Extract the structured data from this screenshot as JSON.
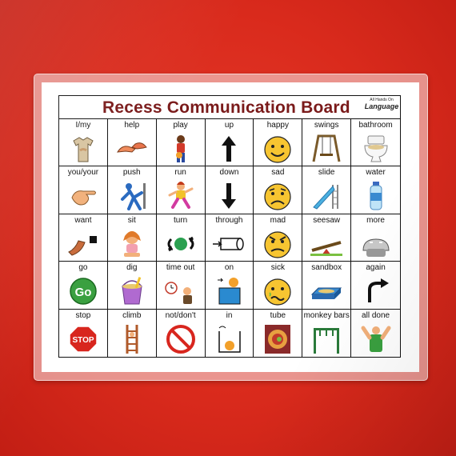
{
  "board": {
    "title": "Recess Communication Board",
    "logo_line1": "All Hands On",
    "logo_line2": "Language",
    "cells": [
      {
        "label": "I/my",
        "icon": "shirt-pointing-self-icon"
      },
      {
        "label": "help",
        "icon": "helping-hands-icon"
      },
      {
        "label": "play",
        "icon": "child-with-ball-icon"
      },
      {
        "label": "up",
        "icon": "arrow-up-icon"
      },
      {
        "label": "happy",
        "icon": "happy-face-icon"
      },
      {
        "label": "swings",
        "icon": "swing-set-icon"
      },
      {
        "label": "bathroom",
        "icon": "toilet-icon"
      },
      {
        "label": "you/your",
        "icon": "pointing-hand-icon"
      },
      {
        "label": "push",
        "icon": "pushing-person-icon"
      },
      {
        "label": "run",
        "icon": "running-child-icon"
      },
      {
        "label": "down",
        "icon": "arrow-down-icon"
      },
      {
        "label": "sad",
        "icon": "sad-face-icon"
      },
      {
        "label": "slide",
        "icon": "playground-slide-icon"
      },
      {
        "label": "water",
        "icon": "water-bottle-icon"
      },
      {
        "label": "want",
        "icon": "reaching-arm-icon"
      },
      {
        "label": "sit",
        "icon": "sitting-girl-icon"
      },
      {
        "label": "turn",
        "icon": "turn-arrows-icon"
      },
      {
        "label": "through",
        "icon": "tunnel-icon"
      },
      {
        "label": "mad",
        "icon": "mad-face-icon"
      },
      {
        "label": "seesaw",
        "icon": "seesaw-icon"
      },
      {
        "label": "more",
        "icon": "more-hands-icon"
      },
      {
        "label": "go",
        "icon": "go-sign-icon"
      },
      {
        "label": "dig",
        "icon": "sand-bucket-icon"
      },
      {
        "label": "time out",
        "icon": "timeout-clock-child-icon"
      },
      {
        "label": "on",
        "icon": "ball-on-box-icon"
      },
      {
        "label": "sick",
        "icon": "sick-face-icon"
      },
      {
        "label": "sandbox",
        "icon": "sandbox-icon"
      },
      {
        "label": "again",
        "icon": "again-arrow-icon"
      },
      {
        "label": "stop",
        "icon": "stop-sign-icon"
      },
      {
        "label": "climb",
        "icon": "climbing-ladder-icon"
      },
      {
        "label": "not/don't",
        "icon": "no-symbol-icon"
      },
      {
        "label": "in",
        "icon": "ball-in-box-icon"
      },
      {
        "label": "tube",
        "icon": "tube-icon"
      },
      {
        "label": "monkey bars",
        "icon": "monkey-bars-icon"
      },
      {
        "label": "all done",
        "icon": "all-done-hands-icon"
      }
    ]
  }
}
